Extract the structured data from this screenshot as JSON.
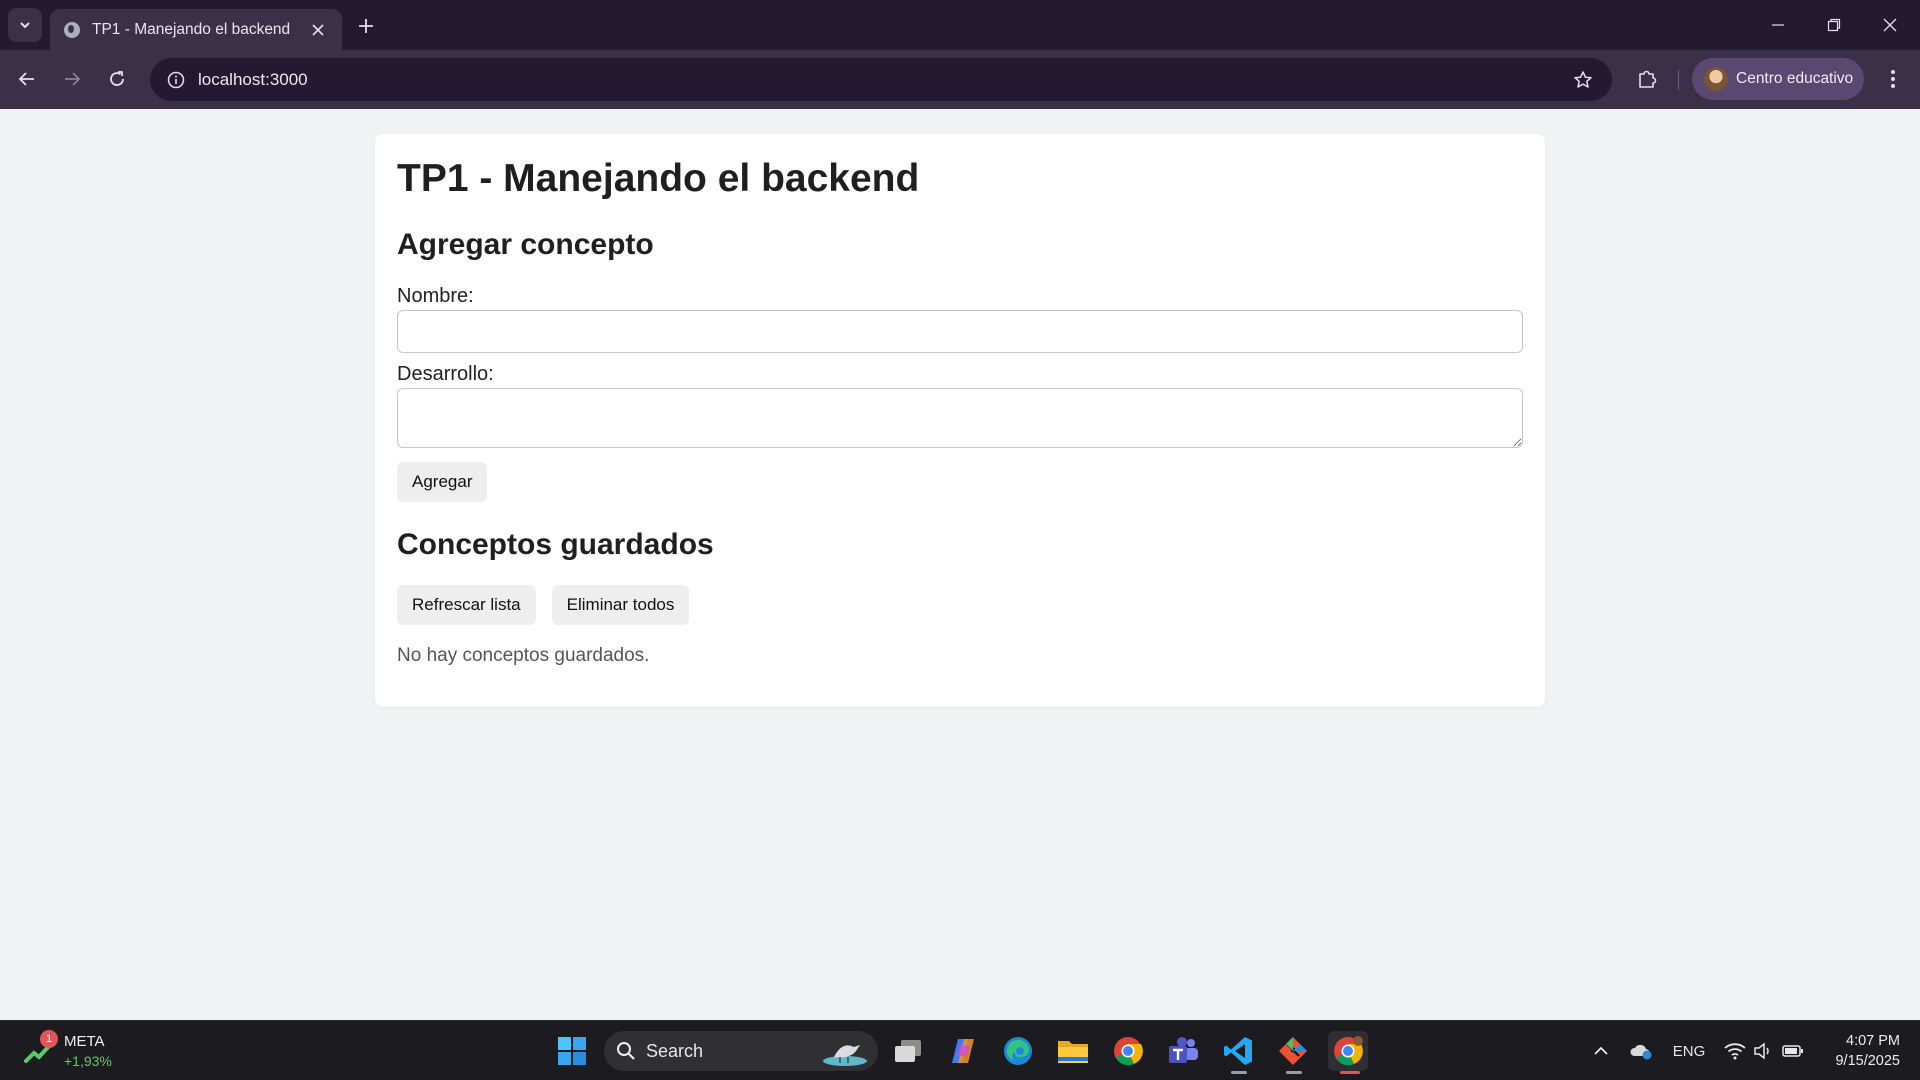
{
  "browser": {
    "tab_title": "TP1 - Manejando el backend",
    "url": "localhost:3000",
    "profile_name": "Centro educativo"
  },
  "page": {
    "title": "TP1 - Manejando el backend",
    "add_section_title": "Agregar concepto",
    "name_label": "Nombre:",
    "name_value": "",
    "description_label": "Desarrollo:",
    "description_value": "",
    "add_button": "Agregar",
    "saved_section_title": "Conceptos guardados",
    "refresh_button": "Refrescar lista",
    "delete_all_button": "Eliminar todos",
    "empty_message": "No hay conceptos guardados."
  },
  "taskbar": {
    "stock_badge": "1",
    "stock_name": "META",
    "stock_change": "+1,93%",
    "search_label": "Search",
    "language": "ENG",
    "time": "4:07 PM",
    "date": "9/15/2025"
  },
  "colors": {
    "tabstrip": "#231a31",
    "toolbar": "#3c3049",
    "page_background": "#f1f2f4",
    "stock_positive": "#5cc96b"
  },
  "icons": [
    "tab-search-icon",
    "globe-icon",
    "close-icon",
    "plus-icon",
    "minimize-icon",
    "restore-icon",
    "back-icon",
    "forward-icon",
    "reload-icon",
    "info-icon",
    "star-icon",
    "extensions-icon",
    "kebab-menu-icon",
    "windows-start-icon",
    "search-icon",
    "task-view-icon",
    "copilot-icon",
    "edge-icon",
    "file-explorer-icon",
    "chrome-icon",
    "teams-icon",
    "vscode-icon",
    "git-icon",
    "chevron-up-icon",
    "onedrive-icon",
    "wifi-icon",
    "volume-icon",
    "battery-icon"
  ]
}
